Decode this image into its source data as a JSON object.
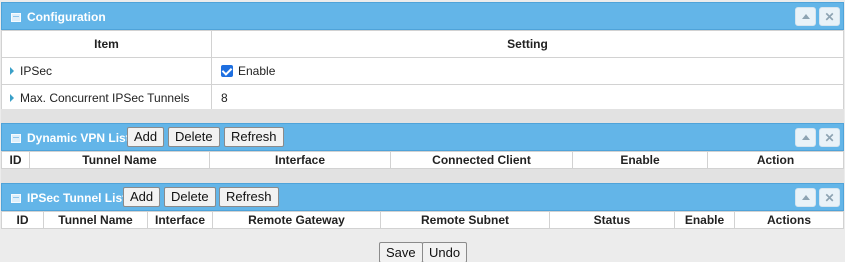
{
  "config": {
    "title": "Configuration",
    "col_item": "Item",
    "col_setting": "Setting",
    "rows": [
      {
        "item": "IPSec",
        "setting_label": "Enable",
        "checked": true
      },
      {
        "item": "Max. Concurrent IPSec Tunnels",
        "setting_value": "8"
      }
    ]
  },
  "dynamic_vpn": {
    "title": "Dynamic VPN List",
    "add_label": "Add",
    "delete_label": "Delete",
    "refresh_label": "Refresh",
    "columns": [
      "ID",
      "Tunnel Name",
      "Interface",
      "Connected Client",
      "Enable",
      "Action"
    ]
  },
  "ipsec_tunnel": {
    "title": "IPSec Tunnel List",
    "add_label": "Add",
    "delete_label": "Delete",
    "refresh_label": "Refresh",
    "columns": [
      "ID",
      "Tunnel Name",
      "Interface",
      "Remote Gateway",
      "Remote Subnet",
      "Status",
      "Enable",
      "Actions"
    ]
  },
  "footer": {
    "save_label": "Save",
    "undo_label": "Undo"
  },
  "colors": {
    "header_bg": "#63b5e8",
    "page_bg": "#ececec",
    "checkbox": "#1e6fe0"
  }
}
